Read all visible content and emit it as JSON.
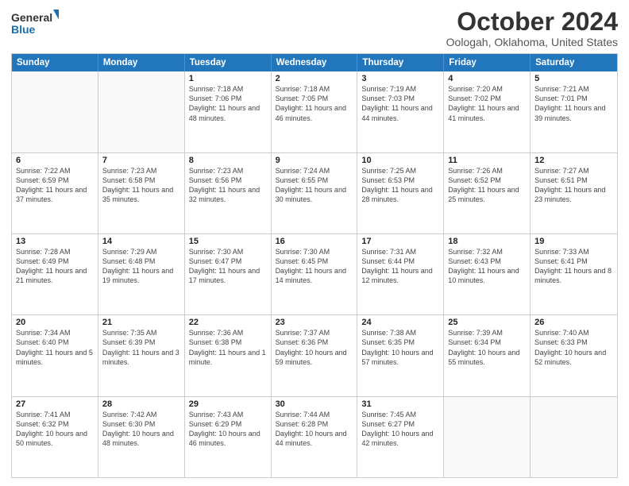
{
  "logo": {
    "line1": "General",
    "line2": "Blue"
  },
  "title": "October 2024",
  "subtitle": "Oologah, Oklahoma, United States",
  "header_days": [
    "Sunday",
    "Monday",
    "Tuesday",
    "Wednesday",
    "Thursday",
    "Friday",
    "Saturday"
  ],
  "weeks": [
    [
      {
        "num": "",
        "info": ""
      },
      {
        "num": "",
        "info": ""
      },
      {
        "num": "1",
        "info": "Sunrise: 7:18 AM\nSunset: 7:06 PM\nDaylight: 11 hours\nand 48 minutes."
      },
      {
        "num": "2",
        "info": "Sunrise: 7:18 AM\nSunset: 7:05 PM\nDaylight: 11 hours\nand 46 minutes."
      },
      {
        "num": "3",
        "info": "Sunrise: 7:19 AM\nSunset: 7:03 PM\nDaylight: 11 hours\nand 44 minutes."
      },
      {
        "num": "4",
        "info": "Sunrise: 7:20 AM\nSunset: 7:02 PM\nDaylight: 11 hours\nand 41 minutes."
      },
      {
        "num": "5",
        "info": "Sunrise: 7:21 AM\nSunset: 7:01 PM\nDaylight: 11 hours\nand 39 minutes."
      }
    ],
    [
      {
        "num": "6",
        "info": "Sunrise: 7:22 AM\nSunset: 6:59 PM\nDaylight: 11 hours\nand 37 minutes."
      },
      {
        "num": "7",
        "info": "Sunrise: 7:23 AM\nSunset: 6:58 PM\nDaylight: 11 hours\nand 35 minutes."
      },
      {
        "num": "8",
        "info": "Sunrise: 7:23 AM\nSunset: 6:56 PM\nDaylight: 11 hours\nand 32 minutes."
      },
      {
        "num": "9",
        "info": "Sunrise: 7:24 AM\nSunset: 6:55 PM\nDaylight: 11 hours\nand 30 minutes."
      },
      {
        "num": "10",
        "info": "Sunrise: 7:25 AM\nSunset: 6:53 PM\nDaylight: 11 hours\nand 28 minutes."
      },
      {
        "num": "11",
        "info": "Sunrise: 7:26 AM\nSunset: 6:52 PM\nDaylight: 11 hours\nand 25 minutes."
      },
      {
        "num": "12",
        "info": "Sunrise: 7:27 AM\nSunset: 6:51 PM\nDaylight: 11 hours\nand 23 minutes."
      }
    ],
    [
      {
        "num": "13",
        "info": "Sunrise: 7:28 AM\nSunset: 6:49 PM\nDaylight: 11 hours\nand 21 minutes."
      },
      {
        "num": "14",
        "info": "Sunrise: 7:29 AM\nSunset: 6:48 PM\nDaylight: 11 hours\nand 19 minutes."
      },
      {
        "num": "15",
        "info": "Sunrise: 7:30 AM\nSunset: 6:47 PM\nDaylight: 11 hours\nand 17 minutes."
      },
      {
        "num": "16",
        "info": "Sunrise: 7:30 AM\nSunset: 6:45 PM\nDaylight: 11 hours\nand 14 minutes."
      },
      {
        "num": "17",
        "info": "Sunrise: 7:31 AM\nSunset: 6:44 PM\nDaylight: 11 hours\nand 12 minutes."
      },
      {
        "num": "18",
        "info": "Sunrise: 7:32 AM\nSunset: 6:43 PM\nDaylight: 11 hours\nand 10 minutes."
      },
      {
        "num": "19",
        "info": "Sunrise: 7:33 AM\nSunset: 6:41 PM\nDaylight: 11 hours\nand 8 minutes."
      }
    ],
    [
      {
        "num": "20",
        "info": "Sunrise: 7:34 AM\nSunset: 6:40 PM\nDaylight: 11 hours\nand 5 minutes."
      },
      {
        "num": "21",
        "info": "Sunrise: 7:35 AM\nSunset: 6:39 PM\nDaylight: 11 hours\nand 3 minutes."
      },
      {
        "num": "22",
        "info": "Sunrise: 7:36 AM\nSunset: 6:38 PM\nDaylight: 11 hours\nand 1 minute."
      },
      {
        "num": "23",
        "info": "Sunrise: 7:37 AM\nSunset: 6:36 PM\nDaylight: 10 hours\nand 59 minutes."
      },
      {
        "num": "24",
        "info": "Sunrise: 7:38 AM\nSunset: 6:35 PM\nDaylight: 10 hours\nand 57 minutes."
      },
      {
        "num": "25",
        "info": "Sunrise: 7:39 AM\nSunset: 6:34 PM\nDaylight: 10 hours\nand 55 minutes."
      },
      {
        "num": "26",
        "info": "Sunrise: 7:40 AM\nSunset: 6:33 PM\nDaylight: 10 hours\nand 52 minutes."
      }
    ],
    [
      {
        "num": "27",
        "info": "Sunrise: 7:41 AM\nSunset: 6:32 PM\nDaylight: 10 hours\nand 50 minutes."
      },
      {
        "num": "28",
        "info": "Sunrise: 7:42 AM\nSunset: 6:30 PM\nDaylight: 10 hours\nand 48 minutes."
      },
      {
        "num": "29",
        "info": "Sunrise: 7:43 AM\nSunset: 6:29 PM\nDaylight: 10 hours\nand 46 minutes."
      },
      {
        "num": "30",
        "info": "Sunrise: 7:44 AM\nSunset: 6:28 PM\nDaylight: 10 hours\nand 44 minutes."
      },
      {
        "num": "31",
        "info": "Sunrise: 7:45 AM\nSunset: 6:27 PM\nDaylight: 10 hours\nand 42 minutes."
      },
      {
        "num": "",
        "info": ""
      },
      {
        "num": "",
        "info": ""
      }
    ]
  ]
}
